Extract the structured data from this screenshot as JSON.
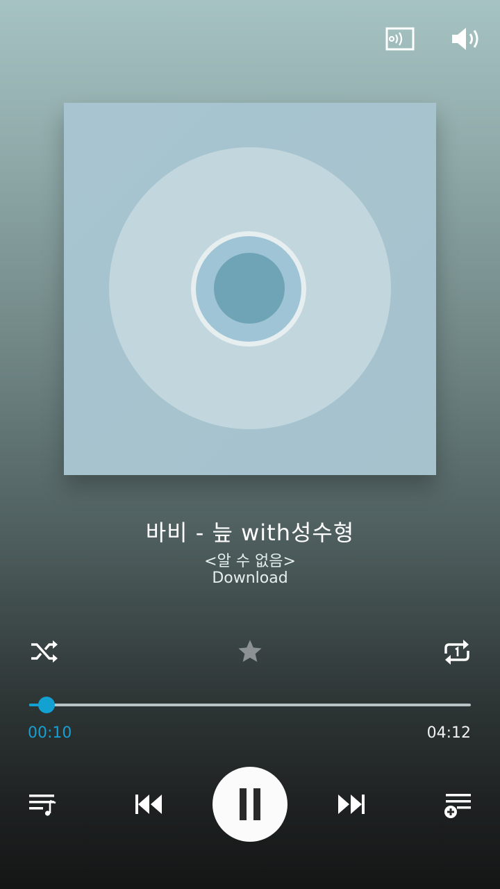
{
  "top_bar": {
    "cast_icon": "screen-mirroring-icon",
    "volume_icon": "volume-icon"
  },
  "album_art": {
    "placeholder_icon": "cd-disc-icon",
    "colors": {
      "background": "#a7c4d0",
      "disc": "#c2d6dd",
      "hub": "#9fc4d5",
      "center": "#6fa4b7"
    }
  },
  "track": {
    "title": "바비 - 늪 with성수형",
    "artist": "<알 수 없음>",
    "source": "Download"
  },
  "controls_row1": {
    "shuffle_icon": "shuffle-icon",
    "favorite_icon": "star-icon",
    "repeat_icon": "repeat-one-icon"
  },
  "progress": {
    "elapsed": "00:10",
    "total": "04:12",
    "fraction": 0.04,
    "accent_color": "#13a1d2"
  },
  "controls_row2": {
    "playlist_icon": "playlist-icon",
    "previous_icon": "skip-previous-icon",
    "pause_icon": "pause-icon",
    "next_icon": "skip-next-icon",
    "add_to_playlist_icon": "playlist-add-icon"
  }
}
